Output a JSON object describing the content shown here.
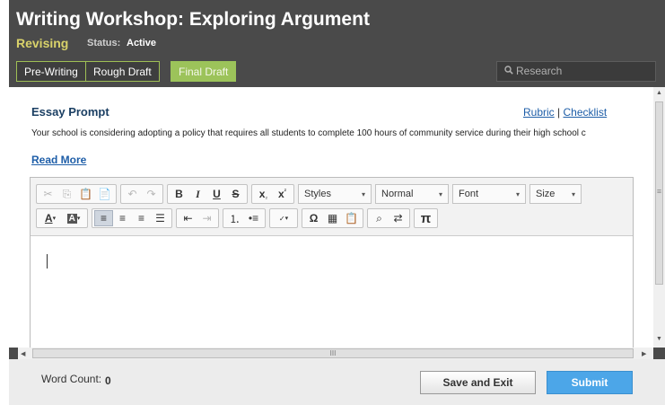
{
  "header": {
    "title": "Writing Workshop: Exploring Argument",
    "stage": "Revising",
    "status_label": "Status:",
    "status_value": "Active"
  },
  "tabs": [
    {
      "label": "Pre-Writing",
      "active": false
    },
    {
      "label": "Rough Draft",
      "active": false
    },
    {
      "label": "Final Draft",
      "active": true
    }
  ],
  "search": {
    "placeholder": "Research",
    "icon": "search-icon"
  },
  "prompt": {
    "title": "Essay Prompt",
    "links": {
      "rubric": "Rubric",
      "separator": "|",
      "checklist": "Checklist"
    },
    "text": "Your school is considering adopting a policy that requires all students to complete 100 hours of community service during their high school c",
    "read_more": "Read More"
  },
  "editor": {
    "toolbar": {
      "styles": "Styles",
      "format": "Normal",
      "font": "Font",
      "size": "Size",
      "bold": "B",
      "italic": "I",
      "underline": "U",
      "strike": "S",
      "omega": "Ω",
      "pi": "π"
    }
  },
  "scrollbar": {
    "h_label": "III",
    "v_label": "≡"
  },
  "footer": {
    "word_count_label": "Word Count:",
    "word_count": "0",
    "save_exit": "Save and Exit",
    "submit": "Submit"
  },
  "colors": {
    "accent_green": "#9cc35a",
    "submit_blue": "#4ca6e8",
    "header_bg": "#4a4a4a"
  }
}
